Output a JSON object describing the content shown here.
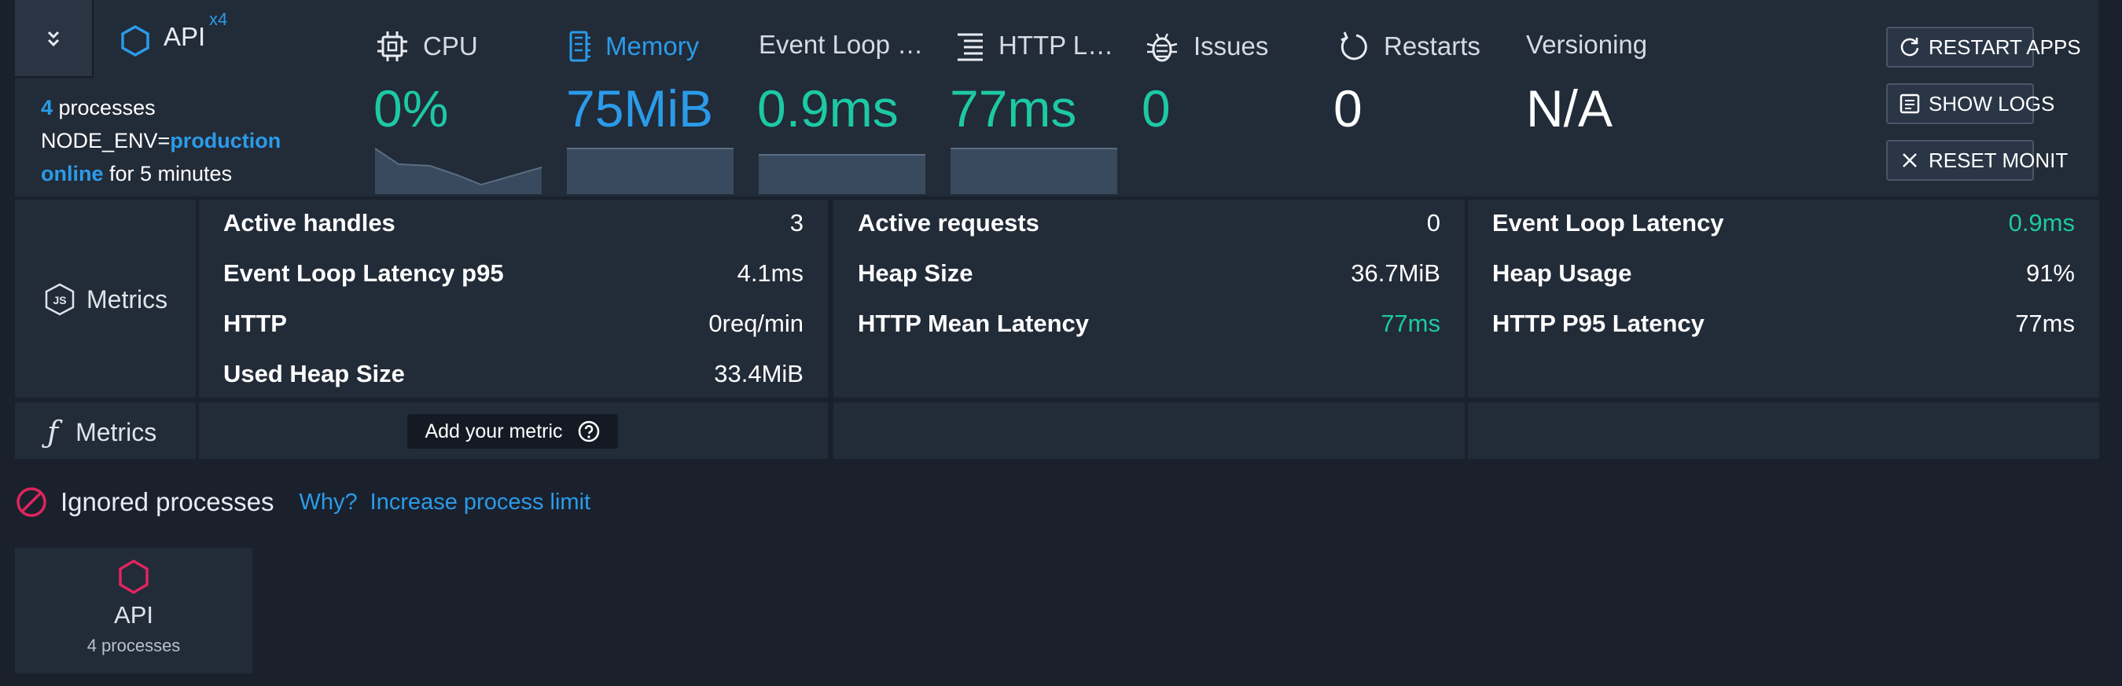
{
  "app": {
    "name": "API",
    "instances_badge": "x4",
    "process_count": "4",
    "processes_label": " processes",
    "env_key": "NODE_ENV=",
    "env_value": "production",
    "status": "online",
    "uptime": " for 5 minutes"
  },
  "header_metrics": [
    {
      "label": "CPU",
      "value": "0%",
      "icon": "cpu-chip-icon",
      "color": "#1dc9a4"
    },
    {
      "label": "Memory",
      "value": "75MiB",
      "icon": "memory-icon",
      "color": "#2b9be9"
    },
    {
      "label": "Event Loop …",
      "value": "0.9ms",
      "icon": "",
      "color": "#1dc9a4"
    },
    {
      "label": "HTTP L…",
      "value": "77ms",
      "icon": "list-lines-icon",
      "color": "#1dc9a4"
    },
    {
      "label": "Issues",
      "value": "0",
      "icon": "bug-icon",
      "color": "#1dc9a4"
    },
    {
      "label": "Restarts",
      "value": "0",
      "icon": "restart-arrow-icon",
      "color": "#ffffff"
    },
    {
      "label": "Versioning",
      "value": "N/A",
      "icon": "",
      "color": "#ffffff"
    }
  ],
  "actions": {
    "restart": "RESTART APPS",
    "logs": "SHOW LOGS",
    "reset": "RESET MONIT"
  },
  "metrics_section": {
    "label": "Metrics",
    "col1": [
      {
        "k": "Active handles",
        "v": "3"
      },
      {
        "k": "Event Loop Latency p95",
        "v": "4.1ms"
      },
      {
        "k": "HTTP",
        "v": "0req/min"
      },
      {
        "k": "Used Heap Size",
        "v": "33.4MiB"
      }
    ],
    "col2": [
      {
        "k": "Active requests",
        "v": "0"
      },
      {
        "k": "Heap Size",
        "v": "36.7MiB"
      },
      {
        "k": "HTTP Mean Latency",
        "v": "77ms"
      }
    ],
    "col3": [
      {
        "k": "Event Loop Latency",
        "v": "0.9ms"
      },
      {
        "k": "Heap Usage",
        "v": "91%"
      },
      {
        "k": "HTTP P95 Latency",
        "v": "77ms"
      }
    ]
  },
  "custom_metrics": {
    "label": "Metrics",
    "add_label": "Add your metric"
  },
  "ignored": {
    "title": "Ignored processes",
    "why": "Why?",
    "increase": "Increase process limit"
  },
  "ignored_card": {
    "name": "API",
    "count_label": "4 processes"
  },
  "colors": {
    "accent_blue": "#2b9be9",
    "accent_green": "#1dc9a4",
    "danger": "#e0245e"
  }
}
